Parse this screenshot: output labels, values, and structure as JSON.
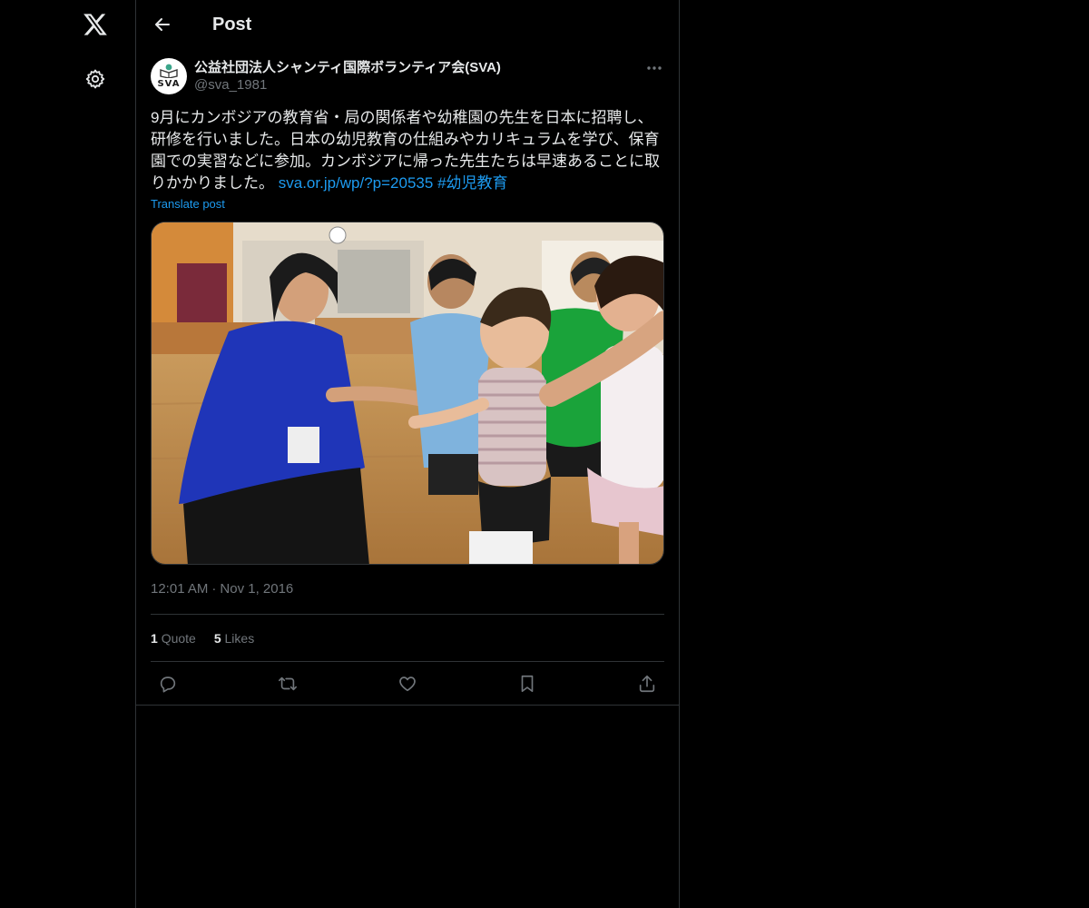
{
  "nav": {
    "logo_icon": "x-logo-icon",
    "settings_icon": "gear-icon"
  },
  "header": {
    "back_icon": "arrow-left-icon",
    "title": "Post"
  },
  "tweet": {
    "author": {
      "display_name": "公益社団法人シャンティ国際ボランティア会(SVA)",
      "handle": "@sva_1981",
      "avatar_text": "SVA"
    },
    "text": "9月にカンボジアの教育省・局の関係者や幼稚園の先生を日本に招聘し、研修を行いました。日本の幼児教育の仕組みやカリキュラムを学び、保育園での実習などに参加。カンボジアに帰った先生たちは早速あることに取りかかりました。 ",
    "link": "sva.or.jp/wp/?p=20535",
    "hashtag": "#幼児教育",
    "translate_label": "Translate post",
    "time": "12:01 AM",
    "separator": "·",
    "date": "Nov 1, 2016",
    "stats": {
      "quotes_count": "1",
      "quotes_label": "Quote",
      "likes_count": "5",
      "likes_label": "Likes"
    }
  },
  "colors": {
    "background": "#000000",
    "text": "#e7e9ea",
    "muted": "#71767b",
    "accent": "#1d9bf0",
    "border": "#2f3336"
  }
}
